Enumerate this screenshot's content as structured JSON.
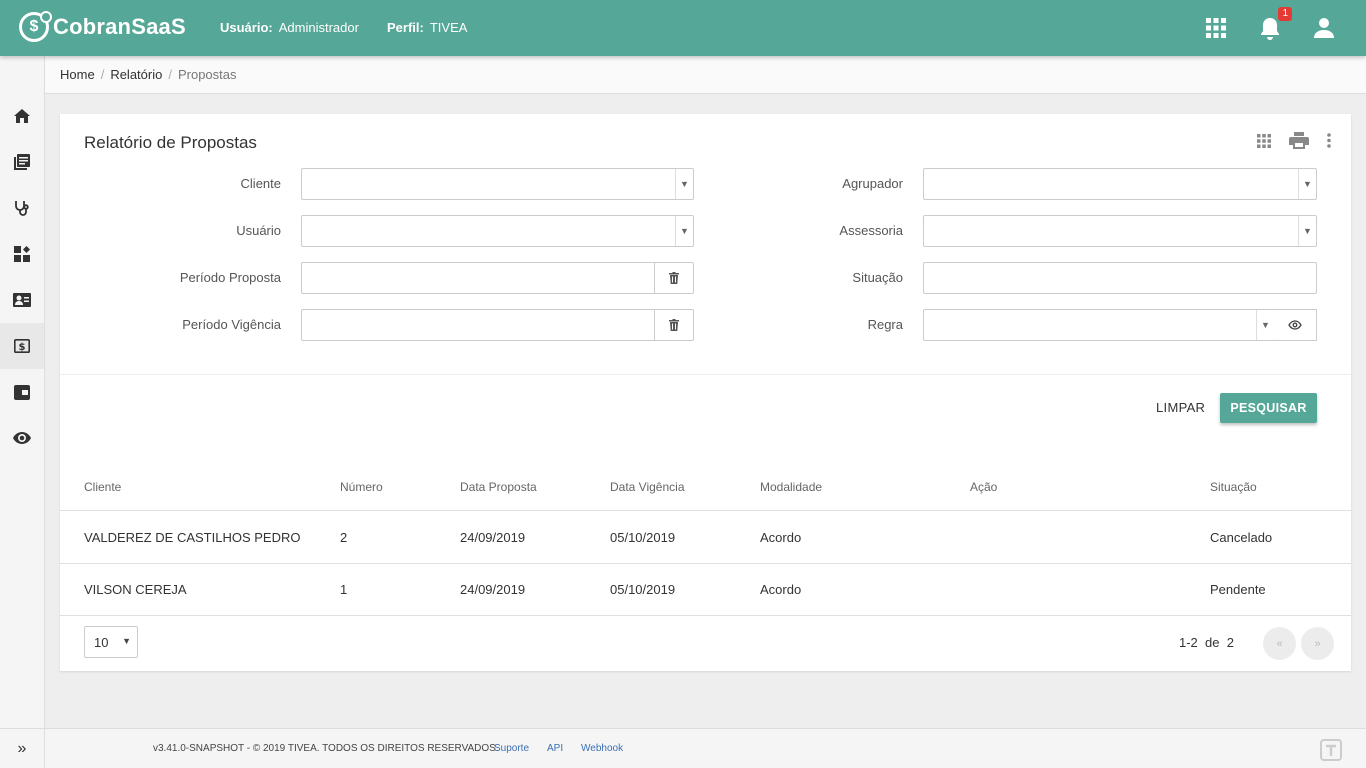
{
  "header": {
    "brand": "CobranSaaS",
    "logo_glyph": "$",
    "user_label": "Usuário:",
    "user_value": "Administrador",
    "profile_label": "Perfil:",
    "profile_value": "TIVEA",
    "notification_count": "1",
    "color": "#55a797"
  },
  "breadcrumb": {
    "home": "Home",
    "sep": "/",
    "report": "Relatório",
    "current": "Propostas"
  },
  "card": {
    "title": "Relatório de Propostas",
    "fields": {
      "cliente": "Cliente",
      "usuario": "Usuário",
      "periodo_proposta": "Período Proposta",
      "periodo_vigencia": "Período Vigência",
      "agrupador": "Agrupador",
      "assessoria": "Assessoria",
      "situacao": "Situação",
      "regra": "Regra"
    },
    "clear_label": "LIMPAR",
    "search_label": "PESQUISAR"
  },
  "table": {
    "columns": [
      "Cliente",
      "Número",
      "Data Proposta",
      "Data Vigência",
      "Modalidade",
      "Ação",
      "Situação"
    ],
    "rows": [
      [
        "VALDEREZ DE CASTILHOS PEDRO",
        "2",
        "24/09/2019",
        "05/10/2019",
        "Acordo",
        "",
        "Cancelado"
      ],
      [
        "VILSON CEREJA",
        "1",
        "24/09/2019",
        "05/10/2019",
        "Acordo",
        "",
        "Pendente"
      ]
    ]
  },
  "pager": {
    "page_size": "10",
    "range": "1-2",
    "of_label": "de",
    "total": "2",
    "prev": "«",
    "next": "»"
  },
  "footer": {
    "copyright": "v3.41.0-SNAPSHOT - © 2019 TIVEA. TODOS OS DIREITOS RESERVADOS.",
    "links": [
      "Suporte",
      "API",
      "Webhook"
    ]
  },
  "sidebar_icons": [
    "home-icon",
    "book-icon",
    "stethoscope-icon",
    "dashboard-icon",
    "contact-card-icon",
    "money-icon",
    "wallet-icon",
    "eye-icon"
  ]
}
